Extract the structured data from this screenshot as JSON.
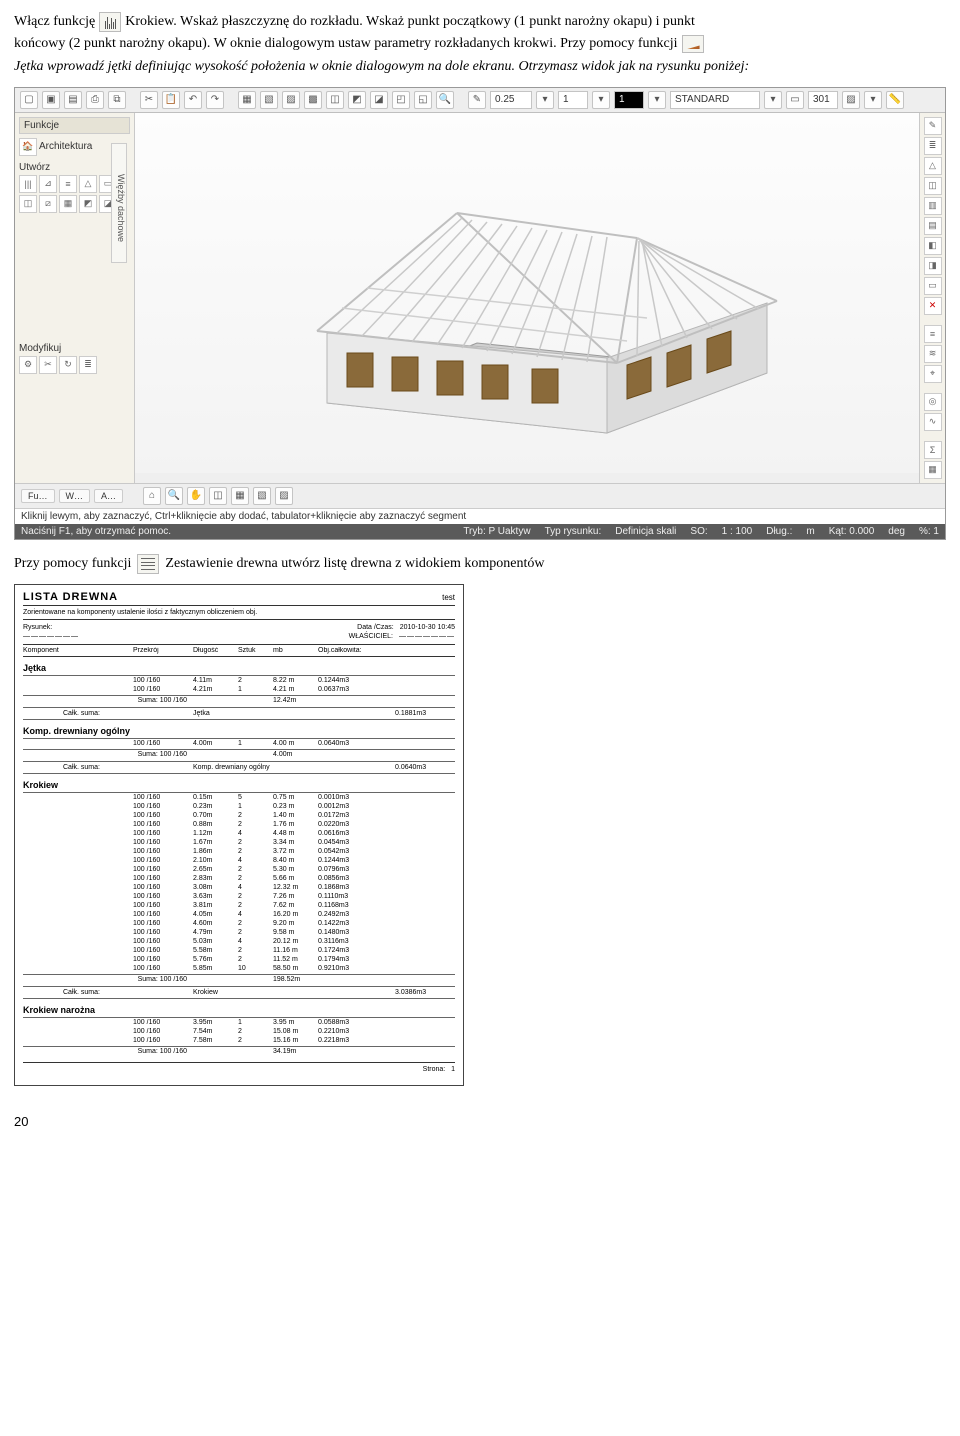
{
  "intro": {
    "t1a": "Włącz funkcję",
    "t1b": "Krokiew. Wskaż płaszczyznę do rozkładu. Wskaż punkt początkowy (1 punkt narożny okapu) i punkt",
    "t2": "końcowy (2 punkt narożny okapu). W oknie dialogowym ustaw parametry rozkładanych krokwi. Przy pomocy funkcji",
    "t3": "Jętka wprowadź jętki definiując wysokość położenia w oknie dialogowym na dole ekranu. Otrzymasz widok jak na rysunku poniżej:"
  },
  "cad": {
    "inputs": {
      "a": "0.25",
      "b": "1",
      "c": "1",
      "layer": "STANDARD",
      "code": "301"
    },
    "panel_funkcje": "Funkcje",
    "panel_arch": "Architektura",
    "label_utworz": "Utwórz",
    "label_modyfikuj": "Modyfikuj",
    "vert_tab": "Więźby dachowe",
    "bottom_tabs": [
      "Fu…",
      "W…",
      "A…"
    ],
    "hint": "Kliknij lewym, aby zaznaczyć, Ctrl+kliknięcie aby dodać, tabulator+kliknięcie aby zaznaczyć segment",
    "help": "Naciśnij F1, aby otrzymać pomoc.",
    "status": {
      "tryb": "Tryb: P Uaktyw",
      "typ": "Typ rysunku:",
      "def": "Definicja skali",
      "so": "SO:",
      "scale": "1 : 100",
      "dlug": "Dług.:",
      "m": "m",
      "kat": "Kąt: 0.000",
      "deg": "deg",
      "pct": "%: 1"
    }
  },
  "mid": {
    "t1": "Przy pomocy funkcji",
    "t2": "Zestawienie drewna utwórz listę drewna z widokiem komponentów"
  },
  "report": {
    "title": "LISTA DREWNA",
    "project": "test",
    "subline": "Zorientowane na komponenty ustalenie ilości z faktycznym obliczeniem obj.",
    "rysunek_label": "Rysunek:",
    "rysunek_dash": "———————",
    "data_label": "Data /Czas:",
    "data_val": "2010-10-30  10:45",
    "wlasciciel_label": "WŁAŚCICIEL:",
    "wlasciciel_dash": "———————",
    "cols": [
      "Komponent",
      "Przekrój",
      "Długość",
      "Sztuk",
      "mb",
      "Obj.całkowita:"
    ],
    "suma_label": "Suma:",
    "calk_label": "Całk. suma:",
    "sections": [
      {
        "name": "Jętka",
        "rows": [
          {
            "shape_w": 25,
            "przekroj": "100 /160",
            "dl": "4.11m",
            "szt": "2",
            "mb": "8.22 m",
            "obj": "0.1244m3"
          },
          {
            "shape_w": 26,
            "przekroj": "100 /160",
            "dl": "4.21m",
            "szt": "1",
            "mb": "4.21 m",
            "obj": "0.0637m3"
          }
        ],
        "suma": {
          "przekroj": "100 /160",
          "mb": "12.42m"
        },
        "tot_name": "Jętka",
        "tot_obj": "0.1881m3"
      },
      {
        "name": "Komp. drewniany ogólny",
        "rows": [
          {
            "shape_w": 24,
            "przekroj": "100 /160",
            "dl": "4.00m",
            "szt": "1",
            "mb": "4.00 m",
            "obj": "0.0640m3"
          }
        ],
        "suma": {
          "przekroj": "100 /160",
          "mb": "4.00m"
        },
        "tot_name": "Komp. drewniany ogólny",
        "tot_obj": "0.0640m3"
      },
      {
        "name": "Krokiew",
        "rows": [
          {
            "shape_w": 3,
            "przekroj": "100 /160",
            "dl": "0.15m",
            "szt": "5",
            "mb": "0.75 m",
            "obj": "0.0010m3"
          },
          {
            "shape_w": 4,
            "przekroj": "100 /160",
            "dl": "0.23m",
            "szt": "1",
            "mb": "0.23 m",
            "obj": "0.0012m3"
          },
          {
            "shape_w": 8,
            "przekroj": "100 /160",
            "dl": "0.70m",
            "szt": "2",
            "mb": "1.40 m",
            "obj": "0.0172m3"
          },
          {
            "shape_w": 10,
            "przekroj": "100 /160",
            "dl": "0.88m",
            "szt": "2",
            "mb": "1.76 m",
            "obj": "0.0220m3"
          },
          {
            "shape_w": 14,
            "przekroj": "100 /160",
            "dl": "1.12m",
            "szt": "4",
            "mb": "4.48 m",
            "obj": "0.0616m3"
          },
          {
            "shape_w": 18,
            "przekroj": "100 /160",
            "dl": "1.67m",
            "szt": "2",
            "mb": "3.34 m",
            "obj": "0.0454m3"
          },
          {
            "shape_w": 20,
            "przekroj": "100 /160",
            "dl": "1.86m",
            "szt": "2",
            "mb": "3.72 m",
            "obj": "0.0542m3"
          },
          {
            "shape_w": 23,
            "przekroj": "100 /160",
            "dl": "2.10m",
            "szt": "4",
            "mb": "8.40 m",
            "obj": "0.1244m3"
          },
          {
            "shape_w": 28,
            "przekroj": "100 /160",
            "dl": "2.65m",
            "szt": "2",
            "mb": "5.30 m",
            "obj": "0.0796m3"
          },
          {
            "shape_w": 30,
            "przekroj": "100 /160",
            "dl": "2.83m",
            "szt": "2",
            "mb": "5.66 m",
            "obj": "0.0856m3"
          },
          {
            "shape_w": 33,
            "przekroj": "100 /160",
            "dl": "3.08m",
            "szt": "4",
            "mb": "12.32 m",
            "obj": "0.1868m3"
          },
          {
            "shape_w": 38,
            "przekroj": "100 /160",
            "dl": "3.63m",
            "szt": "2",
            "mb": "7.26 m",
            "obj": "0.1110m3"
          },
          {
            "shape_w": 40,
            "przekroj": "100 /160",
            "dl": "3.81m",
            "szt": "2",
            "mb": "7.62 m",
            "obj": "0.1168m3"
          },
          {
            "shape_w": 43,
            "przekroj": "100 /160",
            "dl": "4.05m",
            "szt": "4",
            "mb": "16.20 m",
            "obj": "0.2492m3"
          },
          {
            "shape_w": 48,
            "przekroj": "100 /160",
            "dl": "4.60m",
            "szt": "2",
            "mb": "9.20 m",
            "obj": "0.1422m3"
          },
          {
            "shape_w": 50,
            "przekroj": "100 /160",
            "dl": "4.79m",
            "szt": "2",
            "mb": "9.58 m",
            "obj": "0.1480m3"
          },
          {
            "shape_w": 53,
            "przekroj": "100 /160",
            "dl": "5.03m",
            "szt": "4",
            "mb": "20.12 m",
            "obj": "0.3116m3"
          },
          {
            "shape_w": 58,
            "przekroj": "100 /160",
            "dl": "5.58m",
            "szt": "2",
            "mb": "11.16 m",
            "obj": "0.1724m3"
          },
          {
            "shape_w": 60,
            "przekroj": "100 /160",
            "dl": "5.76m",
            "szt": "2",
            "mb": "11.52 m",
            "obj": "0.1794m3"
          },
          {
            "shape_w": 62,
            "przekroj": "100 /160",
            "dl": "5.85m",
            "szt": "10",
            "mb": "58.50 m",
            "obj": "0.9210m3"
          }
        ],
        "suma": {
          "przekroj": "100 /160",
          "mb": "198.52m"
        },
        "tot_name": "Krokiew",
        "tot_obj": "3.0386m3"
      },
      {
        "name": "Krokiew narożna",
        "rows": [
          {
            "shape_w": 34,
            "przekroj": "100 /160",
            "dl": "3.95m",
            "szt": "1",
            "mb": "3.95 m",
            "obj": "0.0588m3"
          },
          {
            "shape_w": 63,
            "przekroj": "100 /160",
            "dl": "7.54m",
            "szt": "2",
            "mb": "15.08 m",
            "obj": "0.2210m3"
          },
          {
            "shape_w": 64,
            "przekroj": "100 /160",
            "dl": "7.58m",
            "szt": "2",
            "mb": "15.16 m",
            "obj": "0.2218m3"
          }
        ],
        "suma": {
          "przekroj": "100 /160",
          "mb": "34.19m"
        },
        "tot_name": "",
        "tot_obj": ""
      }
    ],
    "pager_label": "Strona:",
    "pager_num": "1"
  },
  "page_number": "20"
}
